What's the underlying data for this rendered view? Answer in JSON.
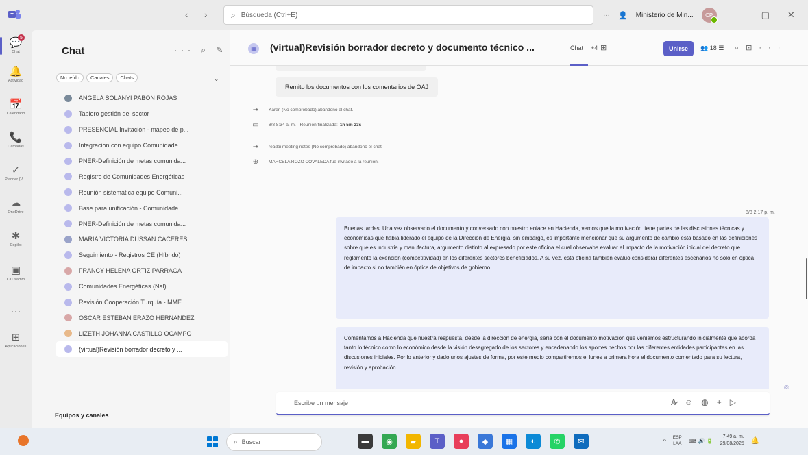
{
  "titlebar": {
    "nav": "‹ ›",
    "search_placeholder": "Búsqueda (Ctrl+E)",
    "org_name": "Ministerio de Min...",
    "avatar_initials": "CP",
    "win_controls": [
      "···",
      "—",
      "▢",
      "✕"
    ]
  },
  "rail": [
    {
      "label": "Chat",
      "glyph": "💬",
      "active": true,
      "badge": "5"
    },
    {
      "label": "Actividad",
      "glyph": "🔔"
    },
    {
      "label": "Calendario",
      "glyph": "📅"
    },
    {
      "label": "Llamadas",
      "glyph": "📞"
    },
    {
      "label": "Planner (Vi...",
      "glyph": "✓"
    },
    {
      "label": "OneDrive",
      "glyph": "☁"
    },
    {
      "label": "Copilot",
      "glyph": "✱"
    },
    {
      "label": "CTCsamm",
      "glyph": "▣"
    },
    {
      "label": "",
      "glyph": "···"
    },
    {
      "label": "Aplicaciones",
      "glyph": "⊞"
    }
  ],
  "chatlist": {
    "title": "Chat",
    "tools": "··· ⌕ ✎",
    "filters": [
      "No leído",
      "Canales",
      "Chats"
    ],
    "items": [
      {
        "name": "ANGELA SOLANYI PABON ROJAS",
        "type": "person"
      },
      {
        "name": "Tablero gestión del sector",
        "type": "meeting"
      },
      {
        "name": "PRESENCIAL Invitación - mapeo de p...",
        "type": "meeting"
      },
      {
        "name": "Integracion con equipo Comunidade...",
        "type": "meeting"
      },
      {
        "name": "PNER-Definición de metas comunida...",
        "type": "meeting"
      },
      {
        "name": "Registro de Comunidades Energéticas",
        "type": "meeting"
      },
      {
        "name": "Reunión sistemática equipo Comuni...",
        "type": "meeting"
      },
      {
        "name": "Base para unificación - Comunidade...",
        "type": "meeting"
      },
      {
        "name": "PNER-Definición de metas comunida...",
        "type": "meeting"
      },
      {
        "name": "MARIA VICTORIA DUSSAN CACERES",
        "type": "blue"
      },
      {
        "name": "Seguimiento - Registros CE (Híbrido)",
        "type": "meeting"
      },
      {
        "name": "FRANCY HELENA ORTIZ PARRAGA",
        "type": "pink"
      },
      {
        "name": "Comunidades Energéticas (Nal)",
        "type": "meeting"
      },
      {
        "name": "Revisión Cooperación Turquía - MME",
        "type": "meeting"
      },
      {
        "name": "OSCAR ESTEBAN ERAZO HERNANDEZ",
        "type": "pink"
      },
      {
        "name": "LIZETH JOHANNA CASTILLO OCAMPO",
        "type": "orange"
      },
      {
        "name": "(virtual)Revisión borrador decreto y ...",
        "type": "meeting",
        "selected": true
      }
    ],
    "section_label": "Equipos y canales"
  },
  "conversation": {
    "title": "(virtual)Revisión borrador decreto y documento técnico ...",
    "tab_label": "Chat",
    "tab_extra": "+4",
    "join_label": "Unirse",
    "people_count": "18",
    "incoming_message": "Remito los documentos con los comentarios de OAJ",
    "system_events": [
      {
        "icon": "person-leave-icon",
        "glyph": "⇥",
        "text": "Karen (No comprobado) abandonó el chat.",
        "bold": ""
      },
      {
        "icon": "meeting-ended-icon",
        "glyph": "▭",
        "text": "8/8 8:34 a. m. · Reunión finalizada:",
        "bold": "1h 5m 23s"
      },
      {
        "icon": "person-leave-icon",
        "glyph": "⇥",
        "text": "readai meeting notes (No comprobado) abandonó el chat.",
        "bold": ""
      },
      {
        "icon": "person-add-icon",
        "glyph": "⊕",
        "text": "MARCELA ROZO COVALEDA fue invitado a la reunión.",
        "bold": ""
      }
    ],
    "out_timestamp": "8/8 2:17 p. m.",
    "out_message_1": "Buenas tardes. Una vez observado el documento y conversado con nuestro enlace en Hacienda, vemos que la motivación tiene partes de las discusiones técnicas y económicas que había liderado el equipo de la Dirección de Energía, sin embargo, es importante mencionar que su argumento de cambio esta basado en las definiciones sobre que es industria y manufactura, argumento distinto al expresado por este oficina el cual observaba evaluar el impacto de la motivación inicial del decreto que reglamento la exención (competitividad) en los diferentes sectores beneficiados. A su vez, esta oficina también evaluó considerar diferentes escenarios no solo en óptica de impacto si no también en óptica de objetivos de gobierno.",
    "out_message_2": "Comentamos a Hacienda que nuestra respuesta, desde la dirección de energía, sería con el documento motivación que veníamos estructurando inicialmente que aborda tanto lo técnico como lo económico desde la visión desagregado de los sectores y encadenando los aportes hechos por las diferentes entidades participantes en las discusiones iniciales. Por lo anterior y dado unos ajustes de forma, por este medio compartiremos el lunes a primera hora el documento comentado para su lectura, revisión y aprobación.",
    "compose_placeholder": "Escribe un mensaje"
  },
  "taskbar": {
    "search_placeholder": "Buscar",
    "apps": [
      {
        "name": "file-explorer-app-icon",
        "color": "#3b3b3b",
        "glyph": "▬"
      },
      {
        "name": "chrome-app-icon",
        "color": "#34a853",
        "glyph": "◉"
      },
      {
        "name": "folder-app-icon",
        "color": "#f2b600",
        "glyph": "▰"
      },
      {
        "name": "teams-app-icon",
        "color": "#5b5fc7",
        "glyph": "T"
      },
      {
        "name": "media-app-icon",
        "color": "#e83e5a",
        "glyph": "●"
      },
      {
        "name": "store-app-icon",
        "color": "#3a78d8",
        "glyph": "◆"
      },
      {
        "name": "calendar-app-icon",
        "color": "#1a73e8",
        "glyph": "▦"
      },
      {
        "name": "edge-app-icon",
        "color": "#0c8ad6",
        "glyph": "◐"
      },
      {
        "name": "whatsapp-app-icon",
        "color": "#25d366",
        "glyph": "✆"
      },
      {
        "name": "outlook-app-icon",
        "color": "#0f6cbd",
        "glyph": "✉"
      }
    ],
    "tray_chevron": "^",
    "lang_1": "ESP",
    "lang_2": "LAA",
    "tray_icons": "⌨ 🔊 🔋",
    "time": "7:49 a. m.",
    "date": "29/08/2025"
  }
}
